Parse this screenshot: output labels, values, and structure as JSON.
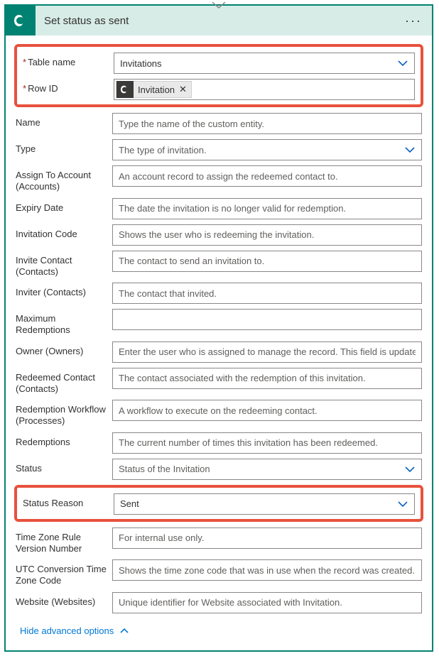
{
  "header": {
    "title": "Set status as sent",
    "icon": "dataverse-swirl-icon"
  },
  "highlight_top": {
    "table_name": {
      "label": "Table name",
      "value": "Invitations"
    },
    "row_id": {
      "label": "Row ID",
      "token": "Invitation"
    }
  },
  "fields": {
    "name": {
      "label": "Name",
      "placeholder": "Type the name of the custom entity."
    },
    "type": {
      "label": "Type",
      "placeholder": "The type of invitation."
    },
    "assign_account": {
      "label": "Assign To Account (Accounts)",
      "placeholder": "An account record to assign the redeemed contact to."
    },
    "expiry": {
      "label": "Expiry Date",
      "placeholder": "The date the invitation is no longer valid for redemption."
    },
    "inv_code": {
      "label": "Invitation Code",
      "placeholder": "Shows the user who is redeeming the invitation."
    },
    "invite_contact": {
      "label": "Invite Contact (Contacts)",
      "placeholder": "The contact to send an invitation to."
    },
    "inviter": {
      "label": "Inviter (Contacts)",
      "placeholder": "The contact that invited."
    },
    "max_redemptions": {
      "label": "Maximum Redemptions",
      "placeholder": ""
    },
    "owner": {
      "label": "Owner (Owners)",
      "placeholder": "Enter the user who is assigned to manage the record. This field is updated eve"
    },
    "redeemed_contact": {
      "label": "Redeemed Contact (Contacts)",
      "placeholder": "The contact associated with the redemption of this invitation."
    },
    "redemption_wf": {
      "label": "Redemption Workflow (Processes)",
      "placeholder": "A workflow to execute on the redeeming contact."
    },
    "redemptions": {
      "label": "Redemptions",
      "placeholder": "The current number of times this invitation has been redeemed."
    },
    "status": {
      "label": "Status",
      "placeholder": "Status of the Invitation"
    }
  },
  "highlight_mid": {
    "status_reason": {
      "label": "Status Reason",
      "value": "Sent"
    }
  },
  "fields2": {
    "tz_rule": {
      "label": "Time Zone Rule Version Number",
      "placeholder": "For internal use only."
    },
    "utc_conv": {
      "label": "UTC Conversion Time Zone Code",
      "placeholder": "Shows the time zone code that was in use when the record was created."
    },
    "website": {
      "label": "Website (Websites)",
      "placeholder": "Unique identifier for Website associated with Invitation."
    }
  },
  "footer": {
    "toggle": "Hide advanced options"
  },
  "colors": {
    "accent": "#008272",
    "highlight": "#e8513d",
    "link": "#0078d4",
    "chevron": "#0b61c5"
  }
}
